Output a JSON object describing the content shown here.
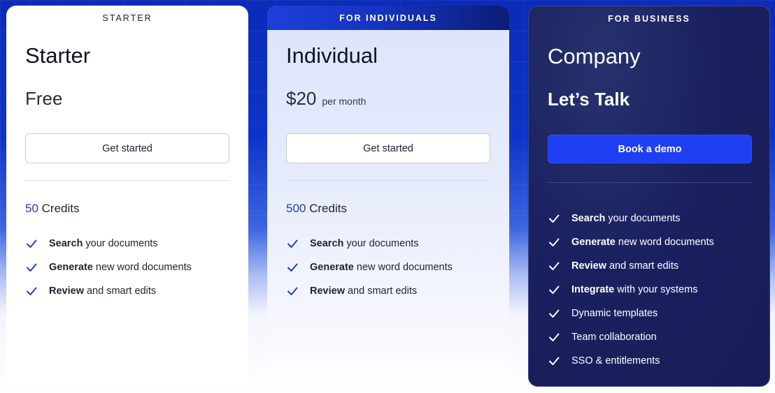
{
  "cards": [
    {
      "tag": "STARTER",
      "name": "Starter",
      "price": "Free",
      "price_suffix": "",
      "cta": "Get started",
      "credits_number": "50",
      "credits_label": "Credits",
      "features": [
        {
          "bold": "Search",
          "rest": "your documents"
        },
        {
          "bold": "Generate",
          "rest": "new word documents"
        },
        {
          "bold": "Review",
          "rest": "and smart edits"
        }
      ]
    },
    {
      "tag": "FOR INDIVIDUALS",
      "name": "Individual",
      "price": "$20",
      "price_suffix": "per month",
      "cta": "Get started",
      "credits_number": "500",
      "credits_label": "Credits",
      "features": [
        {
          "bold": "Search",
          "rest": "your documents"
        },
        {
          "bold": "Generate",
          "rest": "new word documents"
        },
        {
          "bold": "Review",
          "rest": "and smart edits"
        }
      ]
    },
    {
      "tag": "FOR BUSINESS",
      "name": "Company",
      "price": "Let’s Talk",
      "price_suffix": "",
      "cta": "Book a demo",
      "features": [
        {
          "bold": "Search",
          "rest": "your documents"
        },
        {
          "bold": "Generate",
          "rest": "new word documents"
        },
        {
          "bold": "Review",
          "rest": "and smart edits"
        },
        {
          "bold": "Integrate",
          "rest": "with your systems"
        },
        {
          "bold": "",
          "rest": "Dynamic templates"
        },
        {
          "bold": "",
          "rest": "Team collaboration"
        },
        {
          "bold": "",
          "rest": "SSO & entitlements"
        }
      ]
    }
  ],
  "icons": {
    "feature_marker": "check-icon"
  },
  "colors": {
    "accent_blue": "#1e3fc4",
    "cta_business": "#1e3ff2",
    "business_card_bg": "#1b2160"
  }
}
